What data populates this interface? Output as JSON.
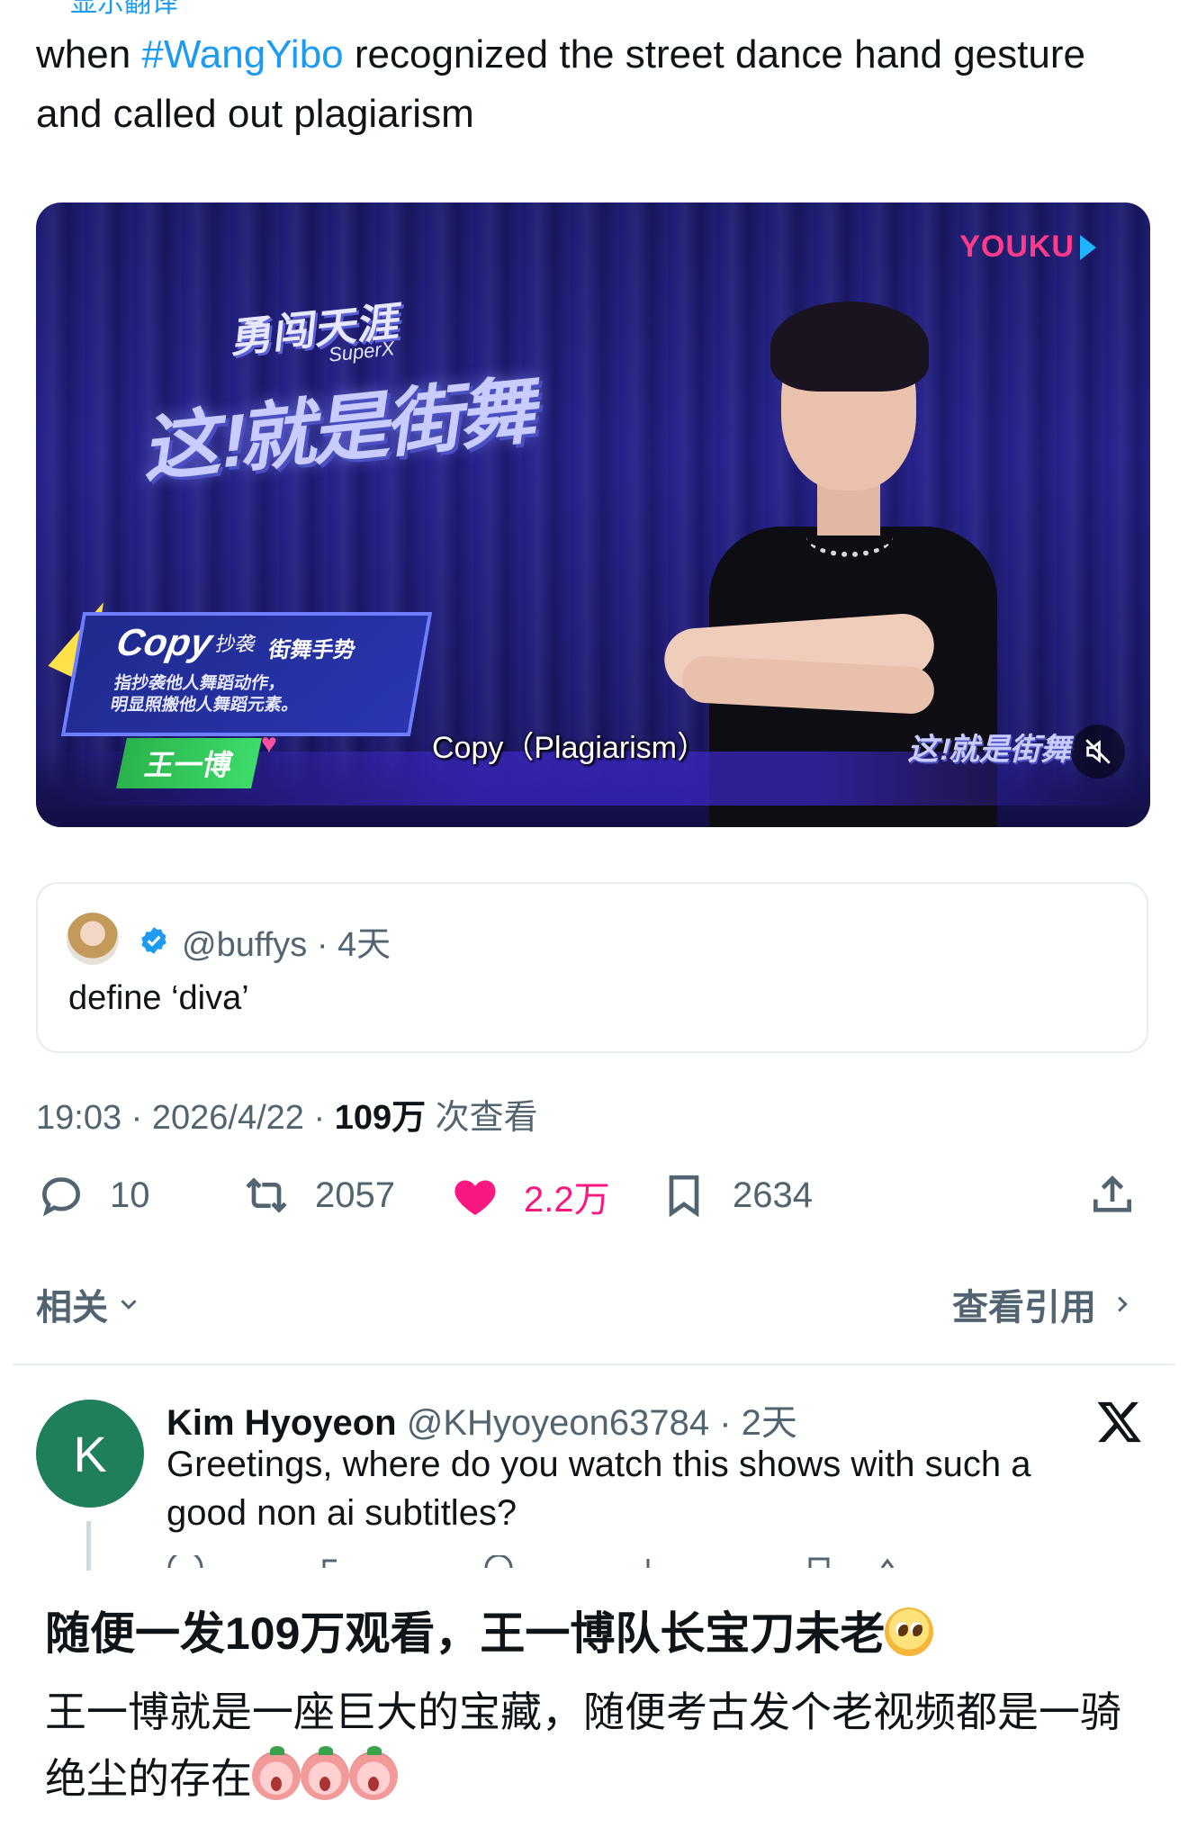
{
  "translate": {
    "label": "显示翻译"
  },
  "tweet": {
    "text_before": "when ",
    "hashtag": "#WangYibo",
    "text_after": " recognized the street dance hand gesture and called out plagiarism"
  },
  "video": {
    "platform_logo": "YOUKU",
    "show_title_top": "勇闯天涯",
    "show_subtitle": "SuperX",
    "show_title_main": "这!就是街舞",
    "caption_copy": "Copy",
    "caption_cn_small": "抄袭",
    "caption_tag": "街舞手势",
    "caption_desc_line1": "指抄袭他人舞蹈动作，",
    "caption_desc_line2": "明显照搬他人舞蹈元素。",
    "name_plate": "王一博",
    "subtitle": "Copy（Plagiarism）",
    "corner_logo": "这!就是街舞",
    "mute_icon": "mute-icon"
  },
  "quote": {
    "handle": "@buffys · 4天",
    "text": "define ‘diva’"
  },
  "meta": {
    "time_date": "19:03 · 2026/4/22 · ",
    "views_count": "109万",
    "views_label": " 次查看"
  },
  "actions": {
    "reply_count": "10",
    "retweet_count": "2057",
    "like_count": "2.2万",
    "bookmark_count": "2634",
    "like_color": "#f91880"
  },
  "related": {
    "label": "相关",
    "view_quotes": "查看引用"
  },
  "reply": {
    "avatar_letter": "K",
    "name": "Kim Hyoyeon",
    "handle_time": " @KHyoyeon63784 · 2天",
    "text": "Greetings, where do you watch this shows with such a good non ai subtitles?"
  },
  "caption": {
    "main": "随便一发109万观看，王一博队长宝刀未老",
    "sub": "王一博就是一座巨大的宝藏，随便考古发个老视频都是一骑绝尘的存在"
  }
}
